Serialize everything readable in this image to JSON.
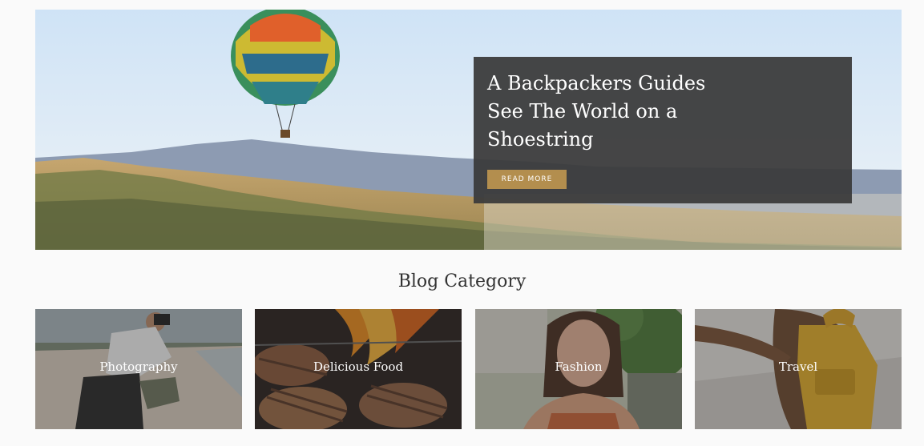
{
  "hero": {
    "title": "A Backpackers Guides See The World on a Shoestring",
    "button_label": "READ MORE"
  },
  "blog_category": {
    "title": "Blog Category",
    "items": [
      {
        "label": "Photography"
      },
      {
        "label": "Delicious Food"
      },
      {
        "label": "Fashion"
      },
      {
        "label": "Travel"
      }
    ]
  },
  "colors": {
    "page_background": "#fafafa",
    "hero_card_background": "#3a3a3a",
    "button_accent": "#b38e4e",
    "text_light": "#ffffff",
    "text_dark": "#333333"
  }
}
